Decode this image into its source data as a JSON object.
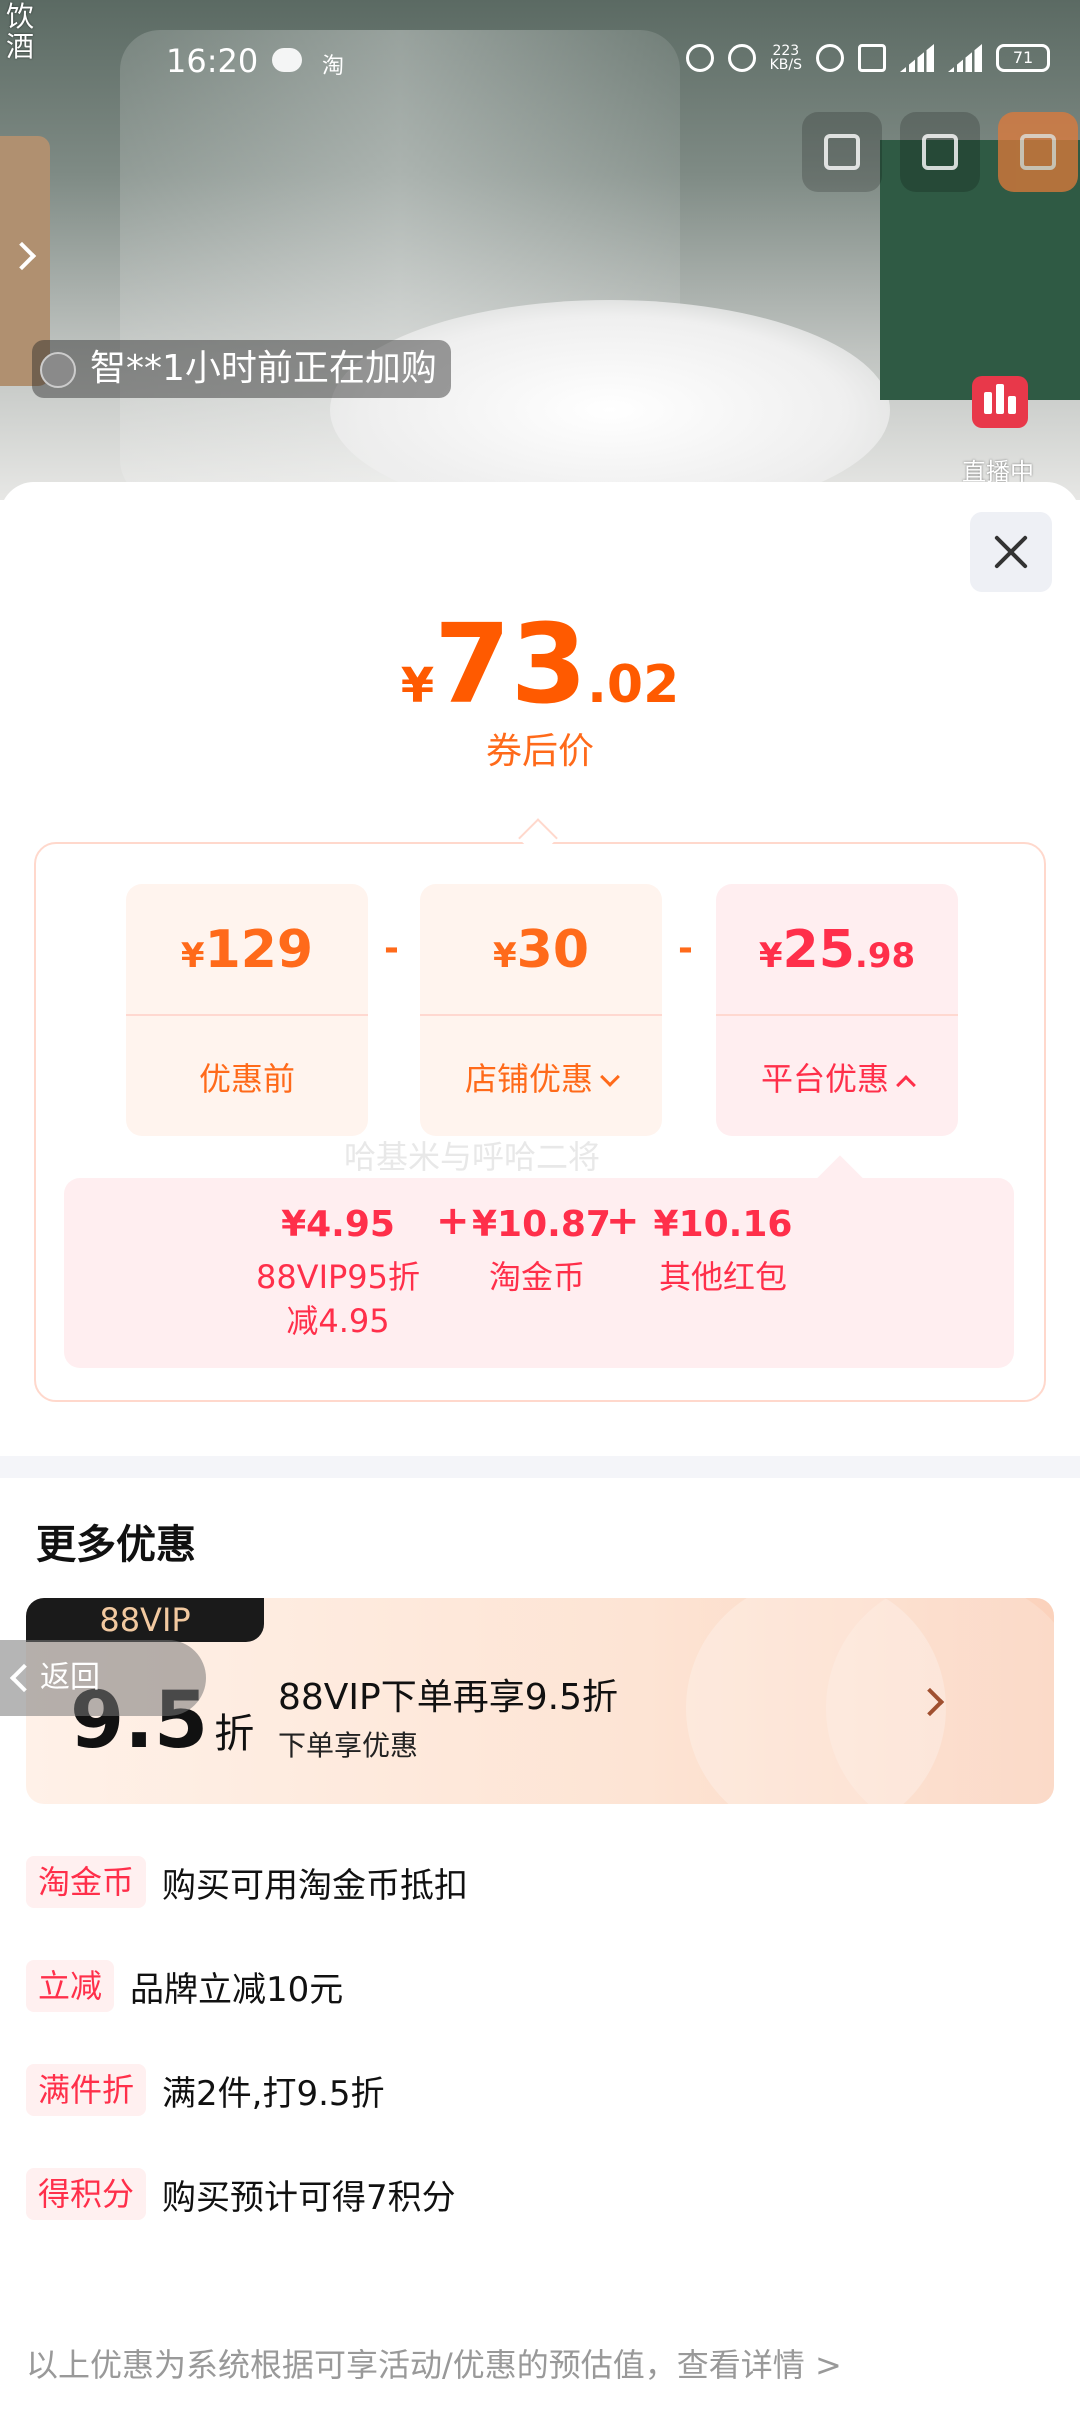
{
  "status_bar": {
    "corner_tag": "饮\n酒",
    "time": "16:20",
    "net_speed": "223\nKB/S",
    "battery": "71"
  },
  "live": {
    "notice": "智**1小时前正在加购",
    "live_label": "直播中"
  },
  "price": {
    "symbol": "¥",
    "integer": "73",
    "decimal": ".02",
    "label": "券后价"
  },
  "breakdown": {
    "original": {
      "symbol": "¥",
      "amount": "129",
      "label": "优惠前"
    },
    "store": {
      "symbol": "¥",
      "amount": "30",
      "label": "店铺优惠"
    },
    "platform": {
      "symbol": "¥",
      "amount": "25",
      "decimal": ".98",
      "label": "平台优惠"
    },
    "minus": "-",
    "plus": "+",
    "items": [
      {
        "value": "¥4.95",
        "label": "88VIP95折\n减4.95"
      },
      {
        "value": "¥10.87",
        "label": "淘金币"
      },
      {
        "value": "¥10.16",
        "label": "其他红包"
      }
    ],
    "watermark": "哈基米与呼哈二将"
  },
  "more": {
    "title": "更多优惠",
    "vip": {
      "tag": "88VIP",
      "rate": "9.5",
      "unit": "折",
      "title": "88VIP下单再享9.5折",
      "subtitle": "下单享优惠"
    },
    "back_label": "返回",
    "promos": [
      {
        "tag": "淘金币",
        "desc": "购买可用淘金币抵扣"
      },
      {
        "tag": "立减",
        "desc": "品牌立减10元"
      },
      {
        "tag": "满件折",
        "desc": "满2件,打9.5折"
      },
      {
        "tag": "得积分",
        "desc": "购买预计可得7积分"
      }
    ]
  },
  "footer": "以上优惠为系统根据可享活动/优惠的预估值，查看详情 >"
}
